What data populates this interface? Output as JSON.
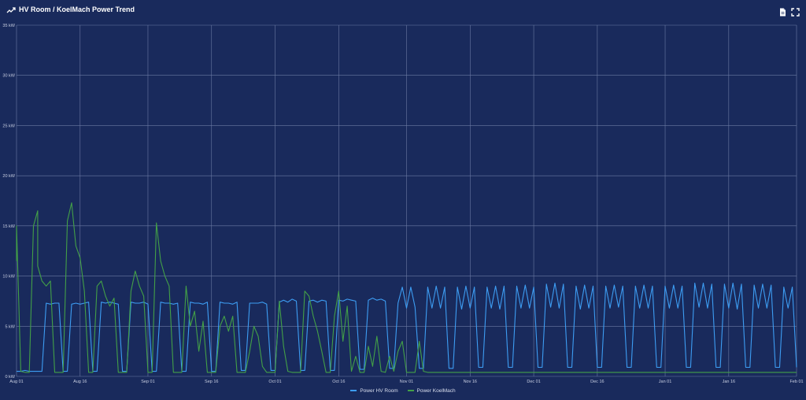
{
  "header": {
    "title": "HV Room / KoelMach Power Trend",
    "title_icon": "trend-line-icon",
    "actions": [
      {
        "name": "export-pdf-button",
        "icon": "document-icon"
      },
      {
        "name": "fullscreen-button",
        "icon": "fullscreen-icon"
      }
    ]
  },
  "chart_data": {
    "type": "line",
    "title": "",
    "xlabel": "",
    "ylabel": "",
    "x_ticks": [
      "Aug 01",
      "Aug 16",
      "Sep 01",
      "Sep 16",
      "Oct 01",
      "Oct 16",
      "Nov 01",
      "Nov 16",
      "Dec 01",
      "Dec 16",
      "Jan 01",
      "Jan 16",
      "Feb 01"
    ],
    "y_ticks": [
      "0 kW",
      "5 kW",
      "10 kW",
      "15 kW",
      "20 kW",
      "25 kW",
      "30 kW",
      "35 kW"
    ],
    "ylim": [
      0,
      35
    ],
    "y_unit": "kW",
    "grid": true,
    "legend_position": "bottom-center",
    "series": [
      {
        "name": "Power HV Room",
        "color": "#3d9df3",
        "points": [
          [
            "Aug 01",
            0.5
          ],
          [
            "Aug 02",
            0.5
          ],
          [
            "Aug 03",
            0.6
          ],
          [
            "Aug 04",
            0.5
          ],
          [
            "Aug 05",
            0.5
          ],
          [
            "Aug 06",
            0.5
          ],
          [
            "Aug 07",
            0.5
          ],
          [
            "Aug 08",
            7.3
          ],
          [
            "Aug 09",
            7.2
          ],
          [
            "Aug 10",
            7.3
          ],
          [
            "Aug 11",
            7.3
          ],
          [
            "Aug 12",
            0.5
          ],
          [
            "Aug 13",
            0.5
          ],
          [
            "Aug 14",
            7.2
          ],
          [
            "Aug 15",
            7.3
          ],
          [
            "Aug 16",
            7.2
          ],
          [
            "Aug 17",
            7.3
          ],
          [
            "Aug 18",
            7.4
          ],
          [
            "Aug 19",
            0.5
          ],
          [
            "Aug 20",
            0.5
          ],
          [
            "Aug 21",
            7.4
          ],
          [
            "Aug 22",
            7.3
          ],
          [
            "Aug 23",
            7.4
          ],
          [
            "Aug 24",
            7.3
          ],
          [
            "Aug 25",
            7.2
          ],
          [
            "Aug 26",
            0.5
          ],
          [
            "Aug 27",
            0.5
          ],
          [
            "Aug 28",
            7.4
          ],
          [
            "Aug 29",
            7.3
          ],
          [
            "Aug 30",
            7.3
          ],
          [
            "Aug 31",
            7.4
          ],
          [
            "Sep 01",
            7.2
          ],
          [
            "Sep 02",
            0.5
          ],
          [
            "Sep 03",
            0.5
          ],
          [
            "Sep 04",
            7.4
          ],
          [
            "Sep 05",
            7.3
          ],
          [
            "Sep 06",
            7.3
          ],
          [
            "Sep 07",
            7.2
          ],
          [
            "Sep 08",
            7.3
          ],
          [
            "Sep 09",
            0.5
          ],
          [
            "Sep 10",
            0.5
          ],
          [
            "Sep 11",
            7.4
          ],
          [
            "Sep 12",
            7.3
          ],
          [
            "Sep 13",
            7.3
          ],
          [
            "Sep 14",
            7.2
          ],
          [
            "Sep 15",
            7.4
          ],
          [
            "Sep 16",
            0.5
          ],
          [
            "Sep 17",
            0.5
          ],
          [
            "Sep 18",
            7.4
          ],
          [
            "Sep 19",
            7.3
          ],
          [
            "Sep 20",
            7.3
          ],
          [
            "Sep 21",
            7.2
          ],
          [
            "Sep 22",
            7.4
          ],
          [
            "Sep 23",
            0.6
          ],
          [
            "Sep 24",
            0.6
          ],
          [
            "Sep 25",
            7.3
          ],
          [
            "Sep 26",
            7.3
          ],
          [
            "Sep 27",
            7.3
          ],
          [
            "Sep 28",
            7.4
          ],
          [
            "Sep 29",
            7.2
          ],
          [
            "Sep 30",
            0.6
          ],
          [
            "Oct 01",
            0.6
          ],
          [
            "Oct 02",
            7.4
          ],
          [
            "Oct 03",
            7.6
          ],
          [
            "Oct 04",
            7.4
          ],
          [
            "Oct 05",
            7.7
          ],
          [
            "Oct 06",
            7.5
          ],
          [
            "Oct 07",
            0.6
          ],
          [
            "Oct 08",
            0.6
          ],
          [
            "Oct 09",
            7.5
          ],
          [
            "Oct 10",
            7.6
          ],
          [
            "Oct 11",
            7.4
          ],
          [
            "Oct 12",
            7.6
          ],
          [
            "Oct 13",
            7.5
          ],
          [
            "Oct 14",
            0.6
          ],
          [
            "Oct 15",
            0.6
          ],
          [
            "Oct 16",
            7.6
          ],
          [
            "Oct 17",
            7.5
          ],
          [
            "Oct 18",
            7.7
          ],
          [
            "Oct 19",
            7.6
          ],
          [
            "Oct 20",
            7.5
          ],
          [
            "Oct 21",
            0.7
          ],
          [
            "Oct 22",
            0.7
          ],
          [
            "Oct 23",
            7.6
          ],
          [
            "Oct 24",
            7.8
          ],
          [
            "Oct 25",
            7.6
          ],
          [
            "Oct 26",
            7.7
          ],
          [
            "Oct 27",
            7.5
          ],
          [
            "Oct 28",
            0.8
          ],
          [
            "Oct 29",
            0.8
          ],
          [
            "Oct 30",
            7.3
          ],
          [
            "Oct 31",
            8.9
          ],
          [
            "Nov 01",
            6.8
          ],
          [
            "Nov 02",
            8.9
          ],
          [
            "Nov 03",
            6.9
          ],
          [
            "Nov 04",
            0.8
          ],
          [
            "Nov 05",
            0.8
          ],
          [
            "Nov 06",
            8.9
          ],
          [
            "Nov 07",
            6.8
          ],
          [
            "Nov 08",
            9.0
          ],
          [
            "Nov 09",
            6.8
          ],
          [
            "Nov 10",
            8.9
          ],
          [
            "Nov 11",
            0.8
          ],
          [
            "Nov 12",
            0.8
          ],
          [
            "Nov 13",
            8.9
          ],
          [
            "Nov 14",
            6.7
          ],
          [
            "Nov 15",
            9.0
          ],
          [
            "Nov 16",
            6.8
          ],
          [
            "Nov 17",
            8.9
          ],
          [
            "Nov 18",
            0.9
          ],
          [
            "Nov 19",
            0.9
          ],
          [
            "Nov 20",
            8.9
          ],
          [
            "Nov 21",
            6.8
          ],
          [
            "Nov 22",
            9.0
          ],
          [
            "Nov 23",
            6.7
          ],
          [
            "Nov 24",
            9.0
          ],
          [
            "Nov 25",
            0.9
          ],
          [
            "Nov 26",
            0.9
          ],
          [
            "Nov 27",
            9.0
          ],
          [
            "Nov 28",
            6.8
          ],
          [
            "Nov 29",
            9.1
          ],
          [
            "Nov 30",
            6.8
          ],
          [
            "Dec 01",
            8.9
          ],
          [
            "Dec 02",
            0.9
          ],
          [
            "Dec 03",
            0.9
          ],
          [
            "Dec 04",
            9.2
          ],
          [
            "Dec 05",
            6.9
          ],
          [
            "Dec 06",
            9.3
          ],
          [
            "Dec 07",
            6.8
          ],
          [
            "Dec 08",
            9.2
          ],
          [
            "Dec 09",
            0.9
          ],
          [
            "Dec 10",
            0.9
          ],
          [
            "Dec 11",
            9.0
          ],
          [
            "Dec 12",
            6.7
          ],
          [
            "Dec 13",
            9.1
          ],
          [
            "Dec 14",
            6.8
          ],
          [
            "Dec 15",
            9.0
          ],
          [
            "Dec 16",
            0.9
          ],
          [
            "Dec 17",
            0.9
          ],
          [
            "Dec 18",
            9.0
          ],
          [
            "Dec 19",
            6.8
          ],
          [
            "Dec 20",
            9.1
          ],
          [
            "Dec 21",
            6.9
          ],
          [
            "Dec 22",
            9.0
          ],
          [
            "Dec 23",
            0.9
          ],
          [
            "Dec 24",
            0.9
          ],
          [
            "Dec 25",
            9.0
          ],
          [
            "Dec 26",
            6.8
          ],
          [
            "Dec 27",
            9.1
          ],
          [
            "Dec 28",
            6.8
          ],
          [
            "Dec 29",
            9.0
          ],
          [
            "Dec 30",
            0.9
          ],
          [
            "Dec 31",
            0.9
          ],
          [
            "Jan 01",
            9.0
          ],
          [
            "Jan 02",
            6.8
          ],
          [
            "Jan 03",
            9.1
          ],
          [
            "Jan 04",
            6.8
          ],
          [
            "Jan 05",
            9.0
          ],
          [
            "Jan 06",
            0.9
          ],
          [
            "Jan 07",
            0.9
          ],
          [
            "Jan 08",
            9.3
          ],
          [
            "Jan 09",
            6.9
          ],
          [
            "Jan 10",
            9.3
          ],
          [
            "Jan 11",
            6.8
          ],
          [
            "Jan 12",
            9.2
          ],
          [
            "Jan 13",
            0.9
          ],
          [
            "Jan 14",
            0.9
          ],
          [
            "Jan 15",
            9.2
          ],
          [
            "Jan 16",
            6.8
          ],
          [
            "Jan 17",
            9.3
          ],
          [
            "Jan 18",
            6.7
          ],
          [
            "Jan 19",
            9.2
          ],
          [
            "Jan 20",
            0.9
          ],
          [
            "Jan 21",
            0.9
          ],
          [
            "Jan 22",
            9.1
          ],
          [
            "Jan 23",
            6.8
          ],
          [
            "Jan 24",
            9.2
          ],
          [
            "Jan 25",
            6.8
          ],
          [
            "Jan 26",
            9.1
          ],
          [
            "Jan 27",
            0.9
          ],
          [
            "Jan 28",
            0.9
          ],
          [
            "Jan 29",
            8.9
          ],
          [
            "Jan 30",
            6.8
          ],
          [
            "Jan 31",
            8.9
          ],
          [
            "Feb 01",
            0.9
          ]
        ]
      },
      {
        "name": "Power KoelMach",
        "color": "#43a047",
        "points": [
          [
            "Aug 01",
            11.5
          ],
          [
            "Aug 01",
            15.0
          ],
          [
            "Aug 02",
            0.5
          ],
          [
            "Aug 03",
            0.4
          ],
          [
            "Aug 04",
            0.4
          ],
          [
            "Aug 05",
            15.0
          ],
          [
            "Aug 06",
            16.5
          ],
          [
            "Aug 06",
            11.0
          ],
          [
            "Aug 07",
            9.5
          ],
          [
            "Aug 08",
            9.0
          ],
          [
            "Aug 09",
            9.5
          ],
          [
            "Aug 10",
            0.4
          ],
          [
            "Aug 11",
            0.4
          ],
          [
            "Aug 12",
            0.4
          ],
          [
            "Aug 13",
            15.5
          ],
          [
            "Aug 14",
            17.3
          ],
          [
            "Aug 15",
            13.0
          ],
          [
            "Aug 16",
            11.8
          ],
          [
            "Aug 17",
            8.5
          ],
          [
            "Aug 18",
            0.4
          ],
          [
            "Aug 19",
            0.4
          ],
          [
            "Aug 20",
            9.0
          ],
          [
            "Aug 21",
            9.5
          ],
          [
            "Aug 22",
            8.0
          ],
          [
            "Aug 23",
            7.0
          ],
          [
            "Aug 24",
            7.8
          ],
          [
            "Aug 25",
            0.4
          ],
          [
            "Aug 26",
            0.4
          ],
          [
            "Aug 27",
            0.4
          ],
          [
            "Aug 28",
            8.5
          ],
          [
            "Aug 29",
            10.5
          ],
          [
            "Aug 30",
            9.0
          ],
          [
            "Aug 31",
            8.0
          ],
          [
            "Sep 01",
            0.4
          ],
          [
            "Sep 02",
            0.4
          ],
          [
            "Sep 03",
            15.3
          ],
          [
            "Sep 04",
            11.5
          ],
          [
            "Sep 05",
            10.0
          ],
          [
            "Sep 06",
            9.0
          ],
          [
            "Sep 07",
            0.4
          ],
          [
            "Sep 08",
            0.4
          ],
          [
            "Sep 09",
            0.4
          ],
          [
            "Sep 10",
            9.0
          ],
          [
            "Sep 11",
            5.0
          ],
          [
            "Sep 12",
            6.5
          ],
          [
            "Sep 13",
            2.5
          ],
          [
            "Sep 14",
            5.5
          ],
          [
            "Sep 15",
            0.4
          ],
          [
            "Sep 16",
            0.4
          ],
          [
            "Sep 17",
            0.4
          ],
          [
            "Sep 18",
            5.0
          ],
          [
            "Sep 19",
            6.0
          ],
          [
            "Sep 20",
            4.5
          ],
          [
            "Sep 21",
            6.0
          ],
          [
            "Sep 22",
            0.4
          ],
          [
            "Sep 23",
            0.4
          ],
          [
            "Sep 24",
            0.4
          ],
          [
            "Sep 25",
            2.5
          ],
          [
            "Sep 26",
            5.0
          ],
          [
            "Sep 27",
            4.0
          ],
          [
            "Sep 28",
            1.0
          ],
          [
            "Sep 29",
            0.4
          ],
          [
            "Sep 30",
            0.4
          ],
          [
            "Oct 01",
            0.4
          ],
          [
            "Oct 02",
            7.5
          ],
          [
            "Oct 03",
            3.0
          ],
          [
            "Oct 04",
            0.5
          ],
          [
            "Oct 05",
            0.4
          ],
          [
            "Oct 06",
            0.4
          ],
          [
            "Oct 07",
            0.4
          ],
          [
            "Oct 08",
            8.5
          ],
          [
            "Oct 09",
            8.0
          ],
          [
            "Oct 10",
            6.0
          ],
          [
            "Oct 11",
            4.5
          ],
          [
            "Oct 12",
            2.5
          ],
          [
            "Oct 13",
            0.4
          ],
          [
            "Oct 14",
            0.4
          ],
          [
            "Oct 15",
            6.0
          ],
          [
            "Oct 16",
            8.5
          ],
          [
            "Oct 17",
            3.5
          ],
          [
            "Oct 18",
            7.0
          ],
          [
            "Oct 19",
            0.5
          ],
          [
            "Oct 20",
            2.0
          ],
          [
            "Oct 21",
            0.4
          ],
          [
            "Oct 22",
            0.4
          ],
          [
            "Oct 23",
            3.0
          ],
          [
            "Oct 24",
            1.0
          ],
          [
            "Oct 25",
            4.0
          ],
          [
            "Oct 26",
            0.5
          ],
          [
            "Oct 27",
            0.4
          ],
          [
            "Oct 28",
            2.0
          ],
          [
            "Oct 29",
            0.5
          ],
          [
            "Oct 30",
            2.5
          ],
          [
            "Oct 31",
            3.5
          ],
          [
            "Nov 01",
            0.4
          ],
          [
            "Nov 02",
            0.4
          ],
          [
            "Nov 03",
            0.4
          ],
          [
            "Nov 04",
            3.5
          ],
          [
            "Nov 05",
            0.5
          ],
          [
            "Nov 06",
            0.4
          ],
          [
            "Nov 10",
            0.4
          ],
          [
            "Nov 16",
            0.4
          ],
          [
            "Dec 01",
            0.4
          ],
          [
            "Dec 16",
            0.4
          ],
          [
            "Jan 01",
            0.4
          ],
          [
            "Jan 16",
            0.4
          ],
          [
            "Feb 01",
            0.4
          ]
        ]
      }
    ]
  }
}
